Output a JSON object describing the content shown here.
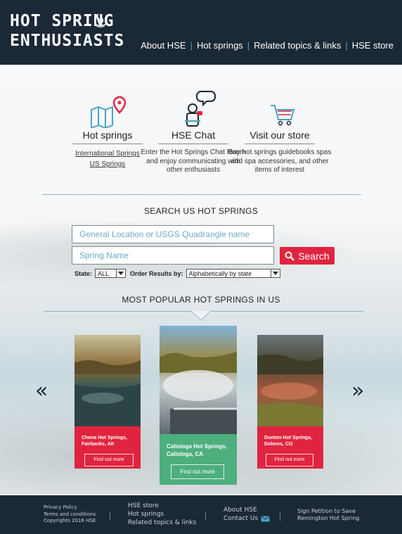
{
  "header": {
    "logo_line1": "HOT SPRING",
    "logo_line2": "ENTHUSIASTS",
    "nav": [
      "About HSE",
      "Hot springs",
      "Related topics & links",
      "HSE store"
    ]
  },
  "features": [
    {
      "title": "Hot springs",
      "links": [
        "International Springs",
        "US Springs"
      ],
      "icon": "map-pin-icon"
    },
    {
      "title": "HSE Chat",
      "desc": "Enter the Hot Springs Chat Room and enjoy communicating with other enthusiasts",
      "icon": "chat-icon"
    },
    {
      "title": "Visit our store",
      "desc": "Buy hot springs guidebooks spas and spa accessories, and other items of interest",
      "icon": "cart-icon"
    }
  ],
  "search": {
    "title": "SEARCH US HOT SPRINGS",
    "location_placeholder": "General Location or USGS Quadrangle name",
    "name_placeholder": "Spring Name",
    "button": "Search",
    "state_label": "State:",
    "state_value": "ALL",
    "order_label": "Order Results by:",
    "order_value": "Alphabetically by state"
  },
  "popular": {
    "title": "MOST POPULAR  HOT SPRINGS IN US",
    "cards": [
      {
        "name": "Chena Hot Springs, Fairbanks, AK",
        "button": "Find out more"
      },
      {
        "name": "Calistoga Hot Springs, Calistoga, CA",
        "button": "Find out more"
      },
      {
        "name": "Dunton Hot Springs, Dolores, CO",
        "button": "Find out more"
      }
    ]
  },
  "footer": {
    "col1": [
      "Privacy Policy",
      "Terms and conditions",
      "Copyrights 2016  HSE"
    ],
    "col2": [
      "HSE store",
      "Hot springs",
      "Related topics & links"
    ],
    "col3": [
      "About HSE",
      "Contact Us"
    ],
    "col4": [
      "Sign Petition to Save",
      "Remington Hot Spring"
    ]
  },
  "colors": {
    "navy": "#1b2836",
    "red": "#e0243f",
    "green": "#4dae7e",
    "accent": "#4aa3c5"
  }
}
